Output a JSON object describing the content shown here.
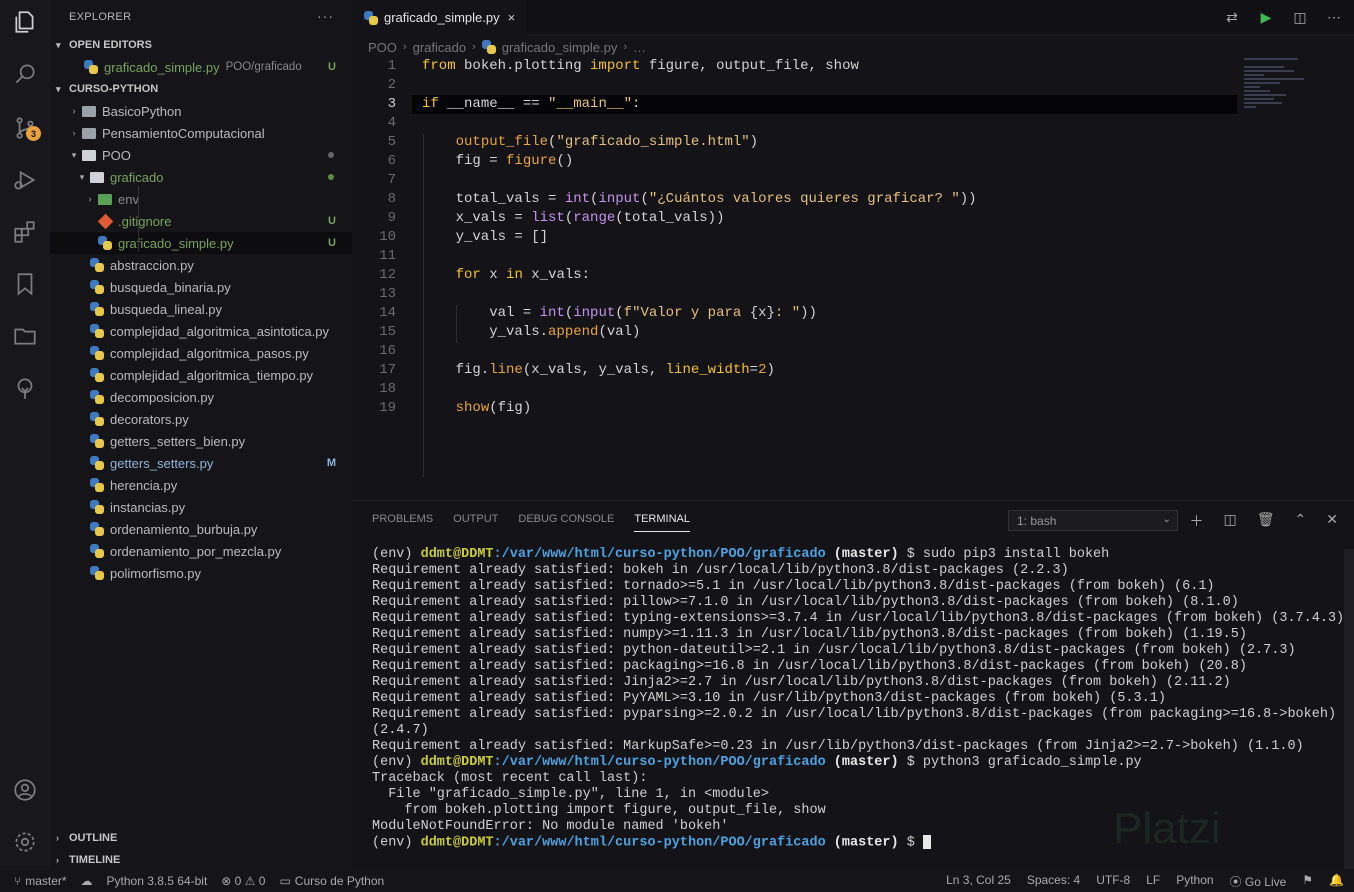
{
  "sidebar": {
    "title": "EXPLORER",
    "more": "···",
    "open_editors": {
      "label": "OPEN EDITORS",
      "items": [
        {
          "name": "graficado_simple.py",
          "path": "POO/graficado",
          "status": "U"
        }
      ]
    },
    "project": {
      "label": "CURSO-PYTHON",
      "folders": [
        "BasicoPython",
        "PensamientoComputacional",
        "POO"
      ],
      "subfolder": "graficado",
      "sub_items": [
        {
          "name": "env",
          "status": ""
        },
        {
          "name": ".gitignore",
          "status": "U"
        },
        {
          "name": "graficado_simple.py",
          "status": "U"
        }
      ],
      "files": [
        {
          "name": "abstraccion.py",
          "status": ""
        },
        {
          "name": "busqueda_binaria.py",
          "status": ""
        },
        {
          "name": "busqueda_lineal.py",
          "status": ""
        },
        {
          "name": "complejidad_algoritmica_asintotica.py",
          "status": ""
        },
        {
          "name": "complejidad_algoritmica_pasos.py",
          "status": ""
        },
        {
          "name": "complejidad_algoritmica_tiempo.py",
          "status": ""
        },
        {
          "name": "decomposicion.py",
          "status": ""
        },
        {
          "name": "decorators.py",
          "status": ""
        },
        {
          "name": "getters_setters_bien.py",
          "status": ""
        },
        {
          "name": "getters_setters.py",
          "status": "M"
        },
        {
          "name": "herencia.py",
          "status": ""
        },
        {
          "name": "instancias.py",
          "status": ""
        },
        {
          "name": "ordenamiento_burbuja.py",
          "status": ""
        },
        {
          "name": "ordenamiento_por_mezcla.py",
          "status": ""
        },
        {
          "name": "polimorfismo.py",
          "status": ""
        }
      ]
    },
    "outline": "OUTLINE",
    "timeline": "TIMELINE"
  },
  "activity": {
    "scm_badge": "3"
  },
  "editor": {
    "tab": "graficado_simple.py",
    "close": "×",
    "breadcrumb": [
      "POO",
      "graficado",
      "graficado_simple.py",
      "…"
    ],
    "line_numbers": [
      "1",
      "2",
      "3",
      "4",
      "5",
      "6",
      "7",
      "8",
      "9",
      "10",
      "11",
      "12",
      "13",
      "14",
      "15",
      "16",
      "17",
      "18",
      "19"
    ]
  },
  "panel": {
    "tabs": [
      "PROBLEMS",
      "OUTPUT",
      "DEBUG CONSOLE",
      "TERMINAL"
    ],
    "active_tab": "TERMINAL",
    "terminal_select": "1: bash",
    "prompt": {
      "env": "(env) ",
      "user": "ddmt@DDMT",
      "path": ":/var/www/html/curso-python/POO/graficado",
      "branch": " (master)",
      "dollar": " $ "
    },
    "commands": [
      "sudo pip3 install bokeh",
      "python3 graficado_simple.py"
    ],
    "output1": [
      "Requirement already satisfied: bokeh in /usr/local/lib/python3.8/dist-packages (2.2.3)",
      "Requirement already satisfied: tornado>=5.1 in /usr/local/lib/python3.8/dist-packages (from bokeh) (6.1)",
      "Requirement already satisfied: pillow>=7.1.0 in /usr/local/lib/python3.8/dist-packages (from bokeh) (8.1.0)",
      "Requirement already satisfied: typing-extensions>=3.7.4 in /usr/local/lib/python3.8/dist-packages (from bokeh) (3.7.4.3)",
      "Requirement already satisfied: numpy>=1.11.3 in /usr/local/lib/python3.8/dist-packages (from bokeh) (1.19.5)",
      "Requirement already satisfied: python-dateutil>=2.1 in /usr/local/lib/python3.8/dist-packages (from bokeh) (2.7.3)",
      "Requirement already satisfied: packaging>=16.8 in /usr/local/lib/python3.8/dist-packages (from bokeh) (20.8)",
      "Requirement already satisfied: Jinja2>=2.7 in /usr/local/lib/python3.8/dist-packages (from bokeh) (2.11.2)",
      "Requirement already satisfied: PyYAML>=3.10 in /usr/lib/python3/dist-packages (from bokeh) (5.3.1)",
      "Requirement already satisfied: pyparsing>=2.0.2 in /usr/local/lib/python3.8/dist-packages (from packaging>=16.8->bokeh)",
      "(2.4.7)",
      "Requirement already satisfied: MarkupSafe>=0.23 in /usr/lib/python3/dist-packages (from Jinja2>=2.7->bokeh) (1.1.0)"
    ],
    "output2": [
      "Traceback (most recent call last):",
      "  File \"graficado_simple.py\", line 1, in <module>",
      "    from bokeh.plotting import figure, output_file, show",
      "ModuleNotFoundError: No module named 'bokeh'"
    ]
  },
  "watermark": "Platzi",
  "status": {
    "branch": "master*",
    "python": "Python 3.8.5 64-bit",
    "problems": "⊗ 0 ⚠ 0",
    "folder": "Curso de Python",
    "position": "Ln 3, Col 25",
    "spaces": "Spaces: 4",
    "encoding": "UTF-8",
    "eol": "LF",
    "language": "Python",
    "live": "Go Live"
  }
}
